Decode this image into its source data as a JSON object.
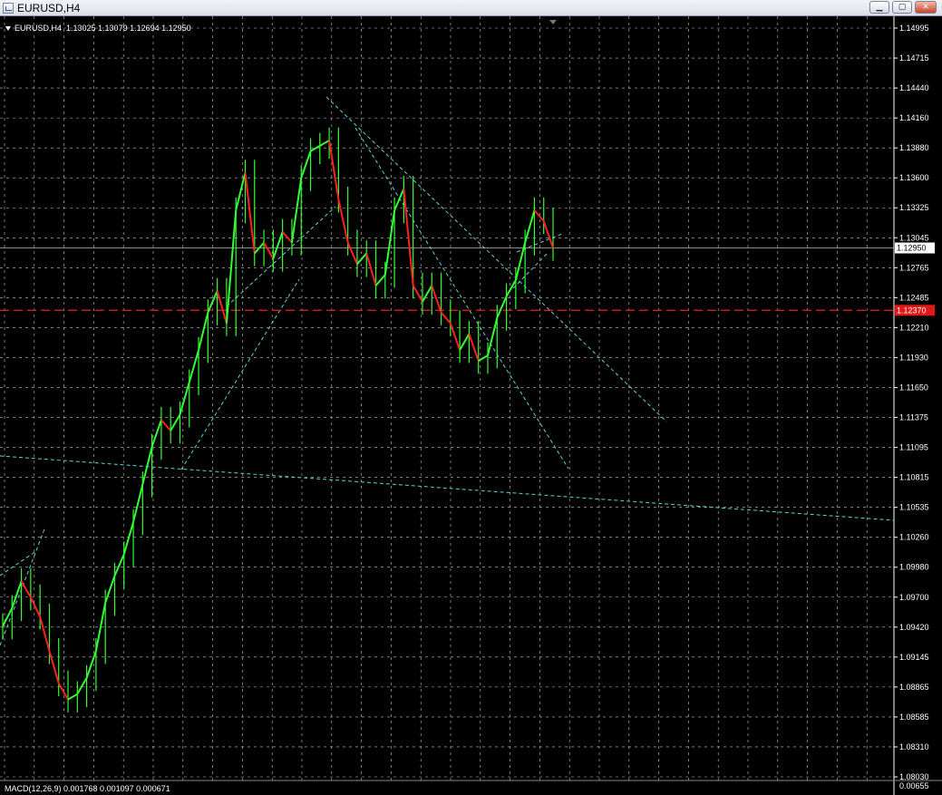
{
  "window": {
    "title": "EURUSD,H4",
    "buttons": [
      {
        "name": "minimize-button",
        "glyph": "▁"
      },
      {
        "name": "maximize-button",
        "glyph": "▢"
      },
      {
        "name": "close-button",
        "glyph": "✕"
      }
    ]
  },
  "chart": {
    "symbol_info": "EURUSD,H4  1.13025 1.13079 1.12694 1.12950",
    "price_axis": [
      "1.14995",
      "1.14715",
      "1.14440",
      "1.14160",
      "1.13880",
      "1.13600",
      "1.13325",
      "1.13045",
      "1.12765",
      "1.12485",
      "1.12210",
      "1.11930",
      "1.11650",
      "1.11375",
      "1.11095",
      "1.10815",
      "1.10535",
      "1.10260",
      "1.09980",
      "1.09700",
      "1.09420",
      "1.09145",
      "1.08865",
      "1.08585",
      "1.08310",
      "1.08030"
    ],
    "current_price_label": "1.12950",
    "level_label": "1.12370",
    "macd_label": "MACD(12,26,9) 0.001768 0.001097 0.000671",
    "macd_axis_top": "0.00655",
    "colors": {
      "background": "#000000",
      "grid": "#c8c8c8",
      "bull_candle": "#33ff33",
      "bear_candle": "#ff2020",
      "trendline": "#5fd3d3",
      "level_line": "#e01818"
    }
  },
  "chart_data": {
    "type": "line",
    "title": "EURUSD,H4",
    "ylim": [
      1.0803,
      1.14995
    ],
    "series": [
      {
        "values": [
          1.0943,
          1.096,
          1.0985,
          1.097,
          1.0952,
          1.092,
          1.089,
          1.0875,
          1.088,
          1.0895,
          1.092,
          1.0965,
          1.099,
          1.101,
          1.104,
          1.1075,
          1.111,
          1.1135,
          1.1125,
          1.114,
          1.117,
          1.12,
          1.1235,
          1.1255,
          1.1225,
          1.133,
          1.1365,
          1.129,
          1.13,
          1.1285,
          1.131,
          1.13,
          1.136,
          1.1385,
          1.139,
          1.1395,
          1.134,
          1.13,
          1.128,
          1.129,
          1.126,
          1.127,
          1.133,
          1.135,
          1.126,
          1.1245,
          1.126,
          1.1235,
          1.1225,
          1.12,
          1.1215,
          1.119,
          1.1195,
          1.123,
          1.125,
          1.1265,
          1.13,
          1.133,
          1.132,
          1.1295
        ]
      }
    ],
    "support_level": 1.1237,
    "current_price": 1.1295
  }
}
